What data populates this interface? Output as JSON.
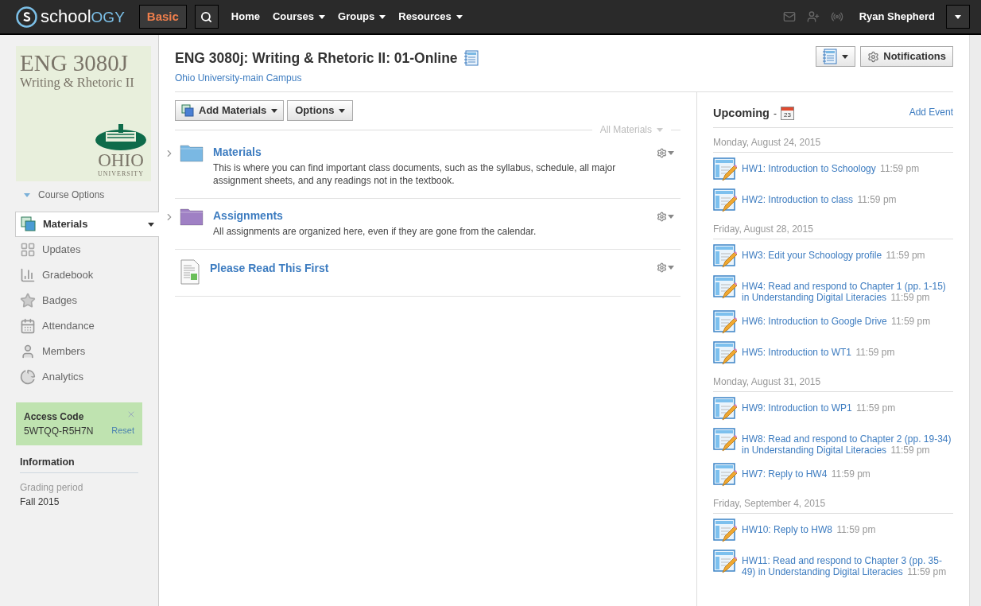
{
  "topbar": {
    "logo": {
      "main": "school",
      "accent": "OGY"
    },
    "basic": {
      "label": "Basic",
      "selected": true
    },
    "nav": [
      {
        "label": "Home",
        "dropdown": false
      },
      {
        "label": "Courses",
        "dropdown": true
      },
      {
        "label": "Groups",
        "dropdown": true
      },
      {
        "label": "Resources",
        "dropdown": true
      }
    ],
    "user": "Ryan Shepherd"
  },
  "sidebar": {
    "course_image": {
      "title": "ENG 3080J",
      "subtitle": "Writing & Rhetoric II",
      "school": "OHIO",
      "school_sub": "UNIVERSITY"
    },
    "course_options": "Course Options",
    "items": [
      {
        "label": "Materials",
        "selected": true
      },
      {
        "label": "Updates",
        "selected": false
      },
      {
        "label": "Gradebook",
        "selected": false
      },
      {
        "label": "Badges",
        "selected": false
      },
      {
        "label": "Attendance",
        "selected": false
      },
      {
        "label": "Members",
        "selected": false
      },
      {
        "label": "Analytics",
        "selected": false
      }
    ],
    "access_code": {
      "title": "Access Code",
      "code": "5WTQQ-R5H7N",
      "reset": "Reset"
    },
    "information": {
      "title": "Information",
      "label": "Grading period",
      "value": "Fall 2015"
    }
  },
  "header": {
    "title": "ENG 3080j: Writing & Rhetoric II: 01-Online",
    "campus": "Ohio University-main Campus",
    "notifications": "Notifications"
  },
  "materials": {
    "add": "Add Materials",
    "options": "Options",
    "filter": "All Materials",
    "items": [
      {
        "kind": "folder",
        "color": "#7ab8e3",
        "title": "Materials",
        "description": "This is where you can find important class documents, such as the syllabus, schedule, all major assignment sheets, and any readings not in the textbook."
      },
      {
        "kind": "folder",
        "color": "#9f80c4",
        "title": "Assignments",
        "description": "All assignments are organized here, even if they are gone from the calendar."
      },
      {
        "kind": "document",
        "title": "Please Read This First"
      }
    ]
  },
  "upcoming": {
    "title": "Upcoming",
    "separator": "-",
    "calendar_day": "23",
    "add_event": "Add Event",
    "groups": [
      {
        "date": "Monday, August 24, 2015",
        "events": [
          {
            "title": "HW1: Introduction to Schoology",
            "time": "11:59 pm"
          },
          {
            "title": "HW2: Introduction to class",
            "time": "11:59 pm"
          }
        ]
      },
      {
        "date": "Friday, August 28, 2015",
        "events": [
          {
            "title": "HW3: Edit your Schoology profile",
            "time": "11:59 pm"
          },
          {
            "title": "HW4: Read and respond to Chapter 1 (pp. 1-15) in Understanding Digital Literacies",
            "time": "11:59 pm"
          },
          {
            "title": "HW6: Introduction to Google Drive",
            "time": "11:59 pm"
          },
          {
            "title": "HW5: Introduction to WT1",
            "time": "11:59 pm"
          }
        ]
      },
      {
        "date": "Monday, August 31, 2015",
        "events": [
          {
            "title": "HW9: Introduction to WP1",
            "time": "11:59 pm"
          },
          {
            "title": "HW8: Read and respond to Chapter 2 (pp. 19-34) in Understanding Digital Literacies",
            "time": "11:59 pm"
          },
          {
            "title": "HW7: Reply to HW4",
            "time": "11:59 pm"
          }
        ]
      },
      {
        "date": "Friday, September 4, 2015",
        "events": [
          {
            "title": "HW10: Reply to HW8",
            "time": "11:59 pm"
          },
          {
            "title": "HW11: Read and respond to Chapter 3 (pp. 35-49) in Understanding Digital Literacies",
            "time": "11:59 pm"
          }
        ]
      }
    ]
  }
}
